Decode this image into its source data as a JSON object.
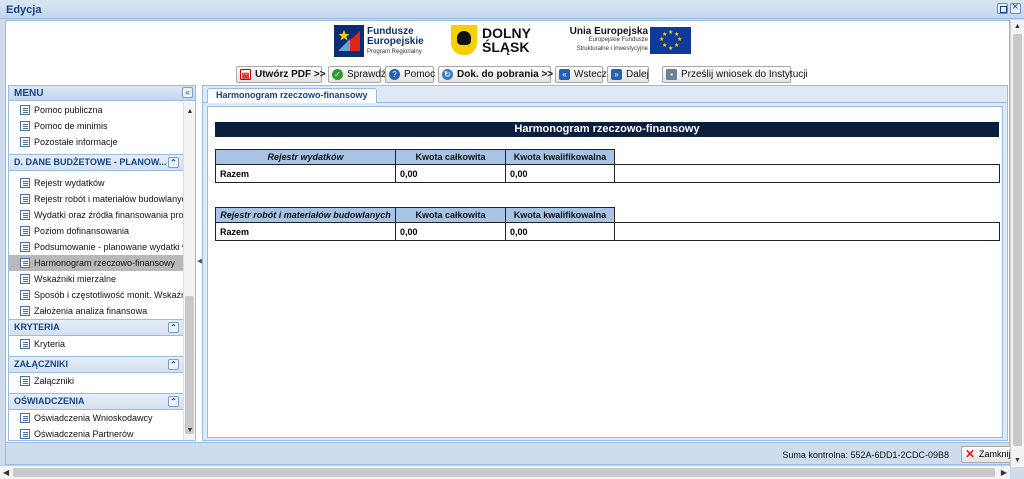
{
  "window": {
    "title": "Edycja"
  },
  "header": {
    "fe_line1": "Fundusze",
    "fe_line2": "Europejskie",
    "fe_line3": "Program Regionalny",
    "ds_line1": "DOLNY",
    "ds_line2": "ŚLĄSK",
    "ue_line1": "Unia Europejska",
    "ue_line2": "Europejskie Fundusze",
    "ue_line3": "Strukturalne i Inwestycyjne"
  },
  "toolbar": {
    "pdf": "Utwórz PDF >>",
    "check": "Sprawdź",
    "help": "Pomoc",
    "docs": "Dok. do pobrania >>",
    "back": "Wstecz",
    "next": "Dalej",
    "send": "Prześlij wniosek do Instytucji"
  },
  "menu": {
    "title": "MENU",
    "items_top": [
      "Pomoc publiczna",
      "Pomoc de minimis",
      "Pozostałe informacje"
    ],
    "section_d": "D. DANE BUDŻETOWE - PLANOW...",
    "items_d": [
      "Rejestr wydatków",
      "Rejestr robót i materiałów budowlanych",
      "Wydatki oraz źródła finansowania projektu",
      "Poziom dofinansowania",
      "Podsumowanie - planowane wydatki w",
      "Harmonogram rzeczowo-finansowy",
      "Wskaźniki mierzalne",
      "Sposób i częstotliwość monit. Wskaźników",
      "Założenia analiza finansowa"
    ],
    "section_k": "KRYTERIA",
    "items_k": [
      "Kryteria"
    ],
    "section_z": "ZAŁĄCZNIKI",
    "items_z": [
      "Załączniki"
    ],
    "section_o": "OŚWIADCZENIA",
    "items_o": [
      "Oświadczenia Wnioskodawcy",
      "Oświadczenia Partnerów"
    ]
  },
  "tab": {
    "label": "Harmonogram rzeczowo-finansowy"
  },
  "sheet": {
    "title": "Harmonogram rzeczowo-finansowy",
    "table1": {
      "headers": [
        "Rejestr wydatków",
        "Kwota całkowita",
        "Kwota kwalifikowalna"
      ],
      "row": [
        "Razem",
        "0,00",
        "0,00"
      ]
    },
    "table2": {
      "headers": [
        "Rejestr robót i materiałów budowlanych",
        "Kwota całkowita",
        "Kwota kwalifikowalna"
      ],
      "row": [
        "Razem",
        "0,00",
        "0,00"
      ]
    }
  },
  "status": {
    "checksum": "Suma kontrolna: 552A-6DD1-2CDC-09B8",
    "close": "Zamknij"
  }
}
